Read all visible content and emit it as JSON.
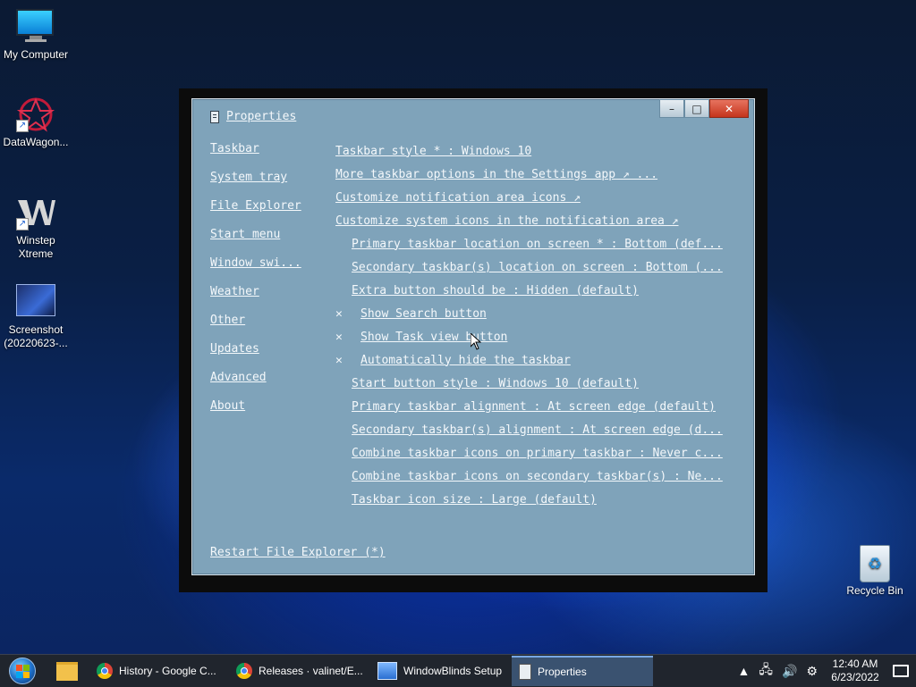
{
  "desktop": {
    "icons": [
      {
        "label": "My Computer",
        "icon": "monitor-icon"
      },
      {
        "label": "DataWagon...",
        "icon": "datawagon-icon"
      },
      {
        "label": "Winstep Xtreme",
        "icon": "winstep-icon"
      },
      {
        "label": "Screenshot (20220623-...",
        "icon": "screenshot-file-icon"
      },
      {
        "label": "Recycle Bin",
        "icon": "recycle-bin-icon"
      }
    ]
  },
  "window": {
    "title": "Properties",
    "controls": {
      "minimize": "–",
      "maximize": "□",
      "close": "✕"
    },
    "nav": [
      "Taskbar",
      "System tray",
      "File Explorer",
      "Start menu",
      "Window swi...",
      "Weather",
      "Other",
      "Updates",
      "Advanced",
      "About"
    ],
    "options": [
      {
        "text": "Taskbar style * : Windows 10",
        "indent": false,
        "check": ""
      },
      {
        "text": "More taskbar options in the Settings app ↗          ...",
        "indent": false,
        "check": ""
      },
      {
        "text": "Customize notification area icons ↗",
        "indent": false,
        "check": ""
      },
      {
        "text": "Customize system icons in the notification area ↗",
        "indent": false,
        "check": ""
      },
      {
        "text": "Primary taskbar location on screen * : Bottom (def...",
        "indent": true,
        "check": ""
      },
      {
        "text": "Secondary taskbar(s) location on screen : Bottom (...",
        "indent": true,
        "check": ""
      },
      {
        "text": "Extra button should be : Hidden (default)",
        "indent": true,
        "check": ""
      },
      {
        "text": "Show Search button",
        "indent": false,
        "check": "✕"
      },
      {
        "text": "Show Task view button",
        "indent": false,
        "check": "✕"
      },
      {
        "text": "Automatically hide the taskbar",
        "indent": false,
        "check": "✕"
      },
      {
        "text": "Start button style : Windows 10 (default)",
        "indent": true,
        "check": ""
      },
      {
        "text": "Primary taskbar alignment : At screen edge (default)",
        "indent": true,
        "check": ""
      },
      {
        "text": "Secondary taskbar(s) alignment : At screen edge (d...",
        "indent": true,
        "check": ""
      },
      {
        "text": "Combine taskbar icons on primary taskbar : Never c...",
        "indent": true,
        "check": ""
      },
      {
        "text": "Combine taskbar icons on secondary taskbar(s) : Ne...",
        "indent": true,
        "check": ""
      },
      {
        "text": "Taskbar icon size : Large (default)",
        "indent": true,
        "check": ""
      }
    ],
    "restart_link": "Restart File Explorer (*)"
  },
  "taskbar": {
    "items": [
      {
        "label": "History - Google C...",
        "icon": "chrome-icon",
        "active": false
      },
      {
        "label": "Releases · valinet/E...",
        "icon": "chrome-icon",
        "active": false
      },
      {
        "label": "WindowBlinds Setup",
        "icon": "windowblinds-icon",
        "active": false
      },
      {
        "label": "Properties",
        "icon": "properties-icon",
        "active": true
      }
    ],
    "clock": {
      "time": "12:40 AM",
      "date": "6/23/2022"
    }
  }
}
